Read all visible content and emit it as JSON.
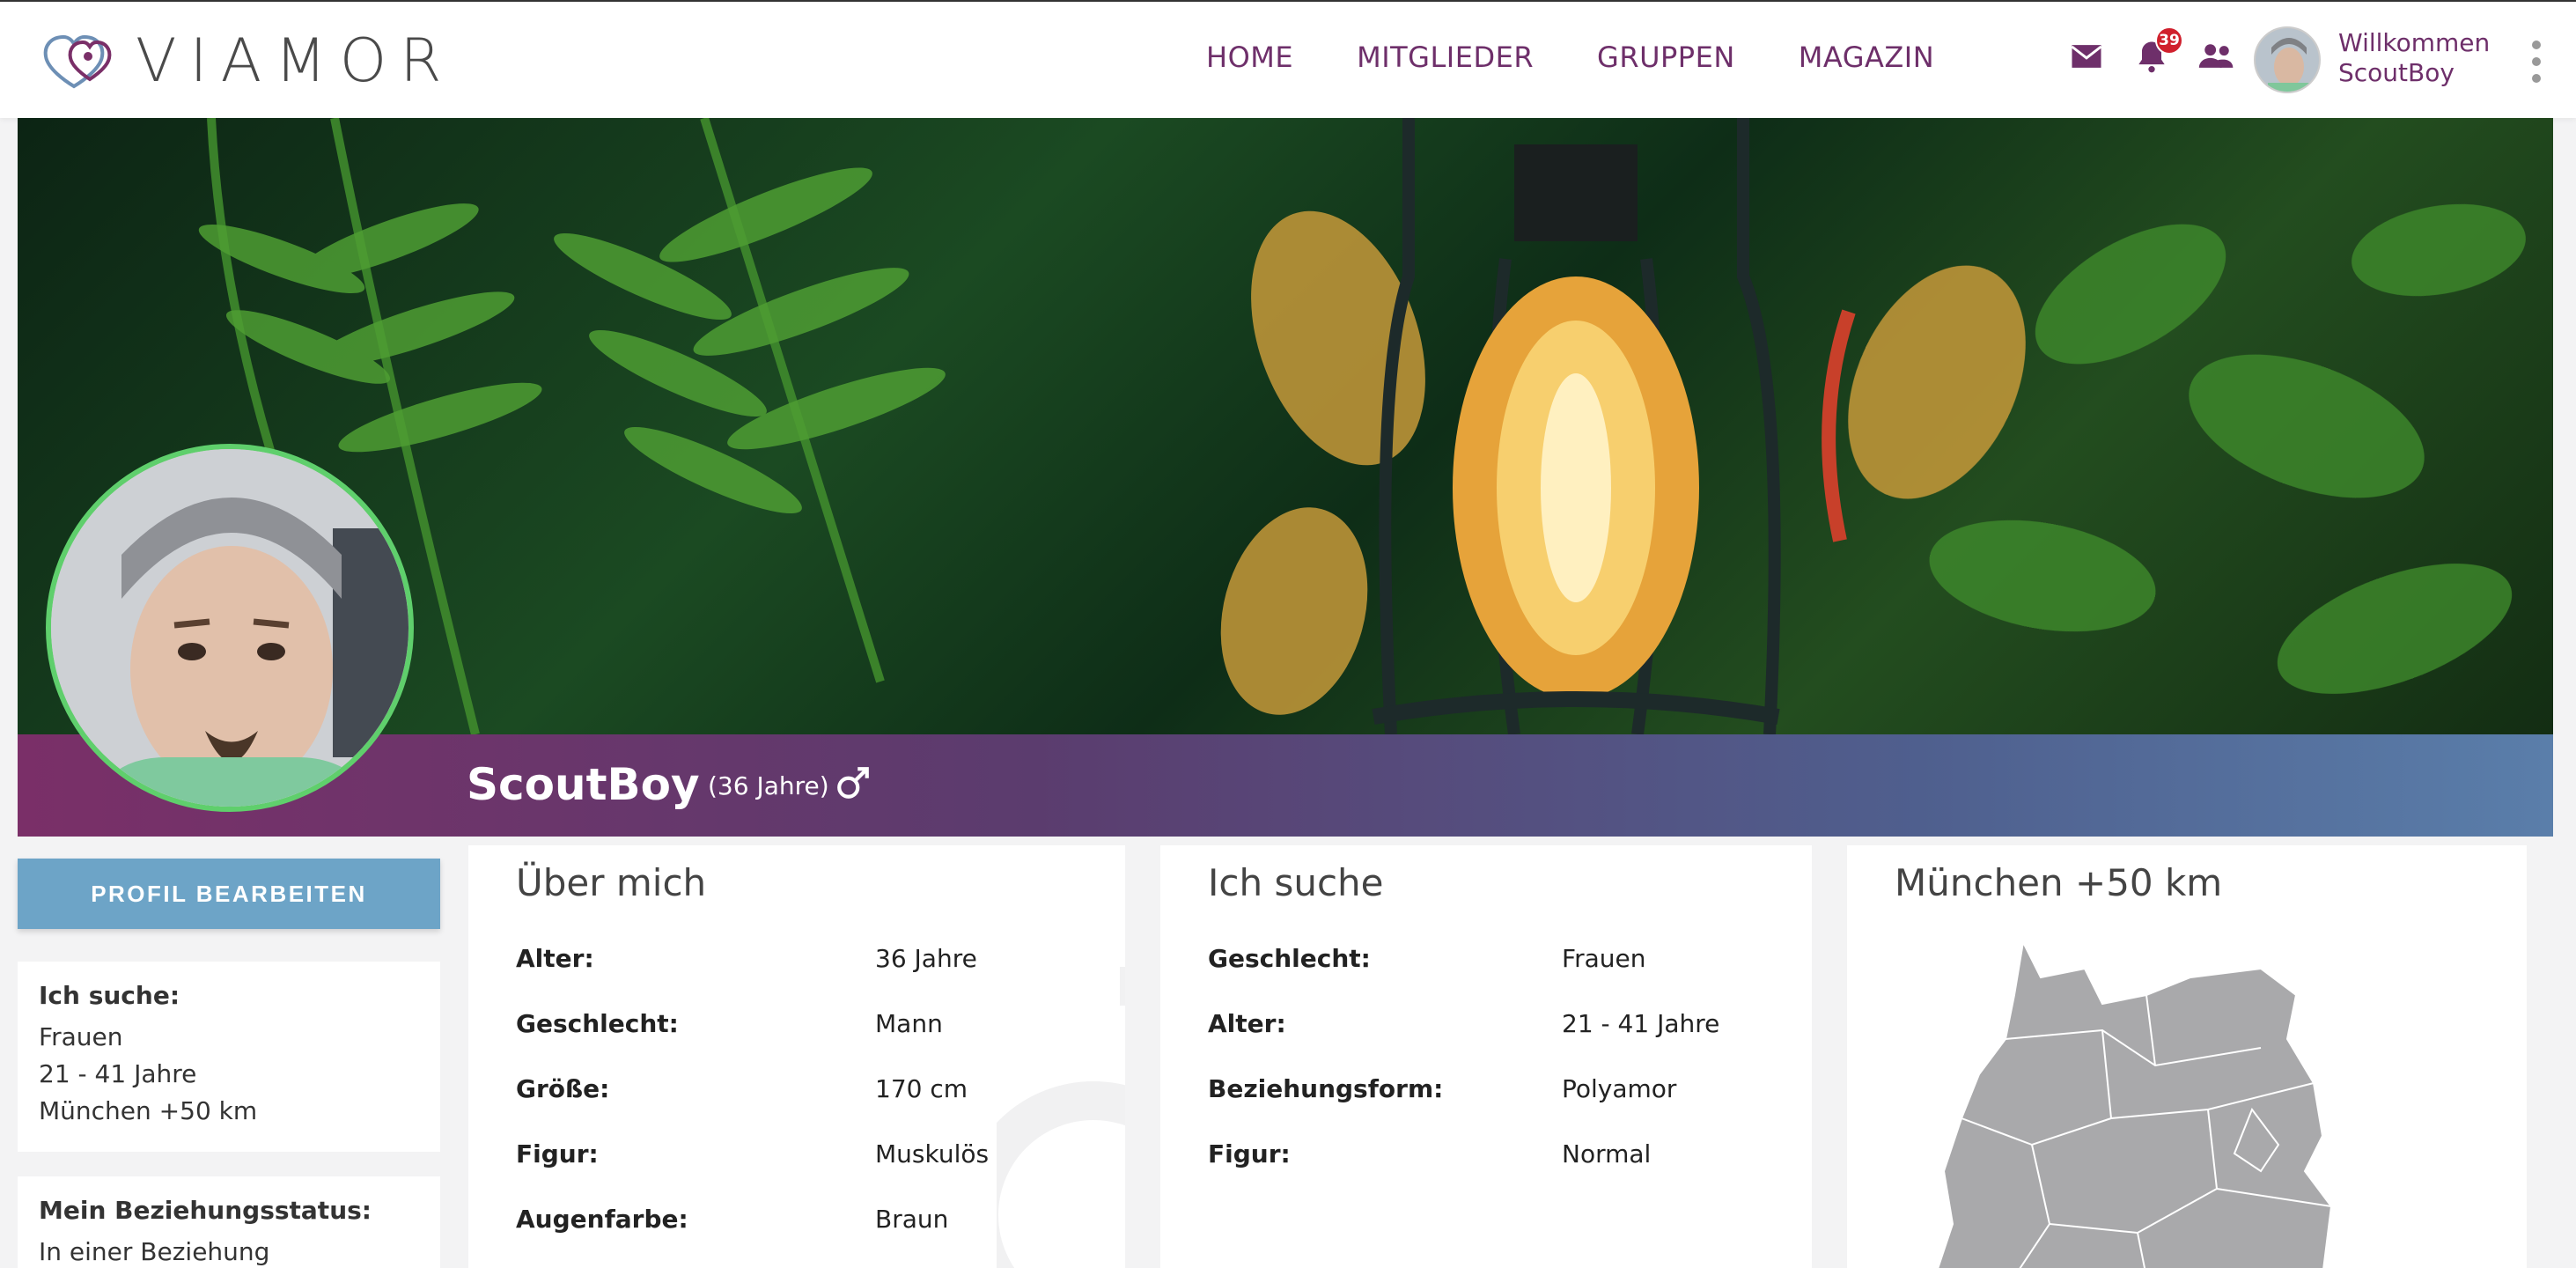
{
  "brand": {
    "name": "VIAMOR"
  },
  "nav": {
    "items": [
      "HOME",
      "MITGLIEDER",
      "GRUPPEN",
      "MAGAZIN"
    ]
  },
  "header": {
    "notification_count": "39",
    "welcome_line1": "Willkommen",
    "welcome_line2": "ScoutBoy"
  },
  "profile": {
    "name": "ScoutBoy",
    "age_text": "(36 Jahre)"
  },
  "sidebar": {
    "edit_button": "PROFIL BEARBEITEN",
    "search_title": "Ich suche:",
    "search_lines": [
      "Frauen",
      "21 - 41 Jahre",
      "München +50 km"
    ],
    "relationship_title": "Mein Beziehungsstatus:",
    "relationship_value": "In einer Beziehung"
  },
  "about": {
    "title": "Über mich",
    "rows": [
      {
        "label": "Alter:",
        "value": "36 Jahre"
      },
      {
        "label": "Geschlecht:",
        "value": "Mann"
      },
      {
        "label": "Größe:",
        "value": "170 cm"
      },
      {
        "label": "Figur:",
        "value": "Muskulös"
      },
      {
        "label": "Augenfarbe:",
        "value": "Braun"
      }
    ]
  },
  "seeking": {
    "title": "Ich suche",
    "rows": [
      {
        "label": "Geschlecht:",
        "value": "Frauen"
      },
      {
        "label": "Alter:",
        "value": "21 - 41 Jahre"
      },
      {
        "label": "Beziehungsform:",
        "value": "Polyamor"
      },
      {
        "label": "Figur:",
        "value": "Normal"
      }
    ]
  },
  "location": {
    "title": "München +50 km"
  },
  "colors": {
    "brand_purple": "#6e2f6a",
    "button_blue": "#6da4c7",
    "avatar_ring": "#5fcf6c",
    "badge_red": "#d0202d"
  }
}
